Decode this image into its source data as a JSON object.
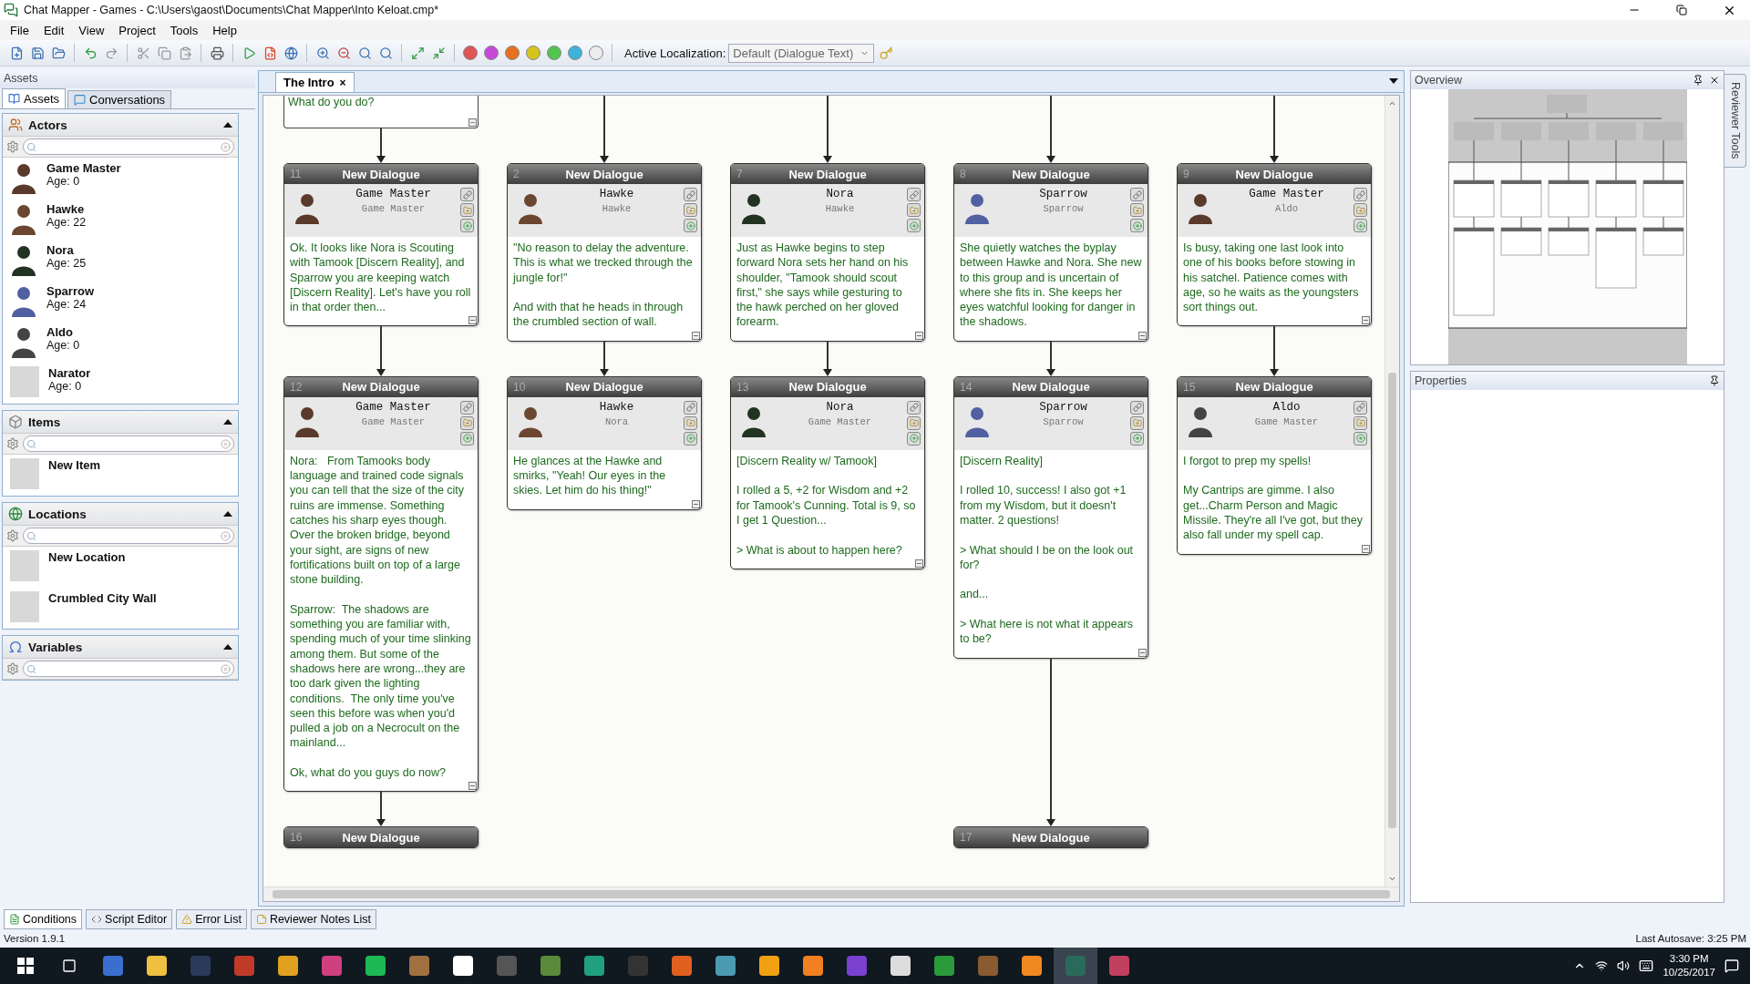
{
  "window": {
    "title": "Chat Mapper - Games - C:\\Users\\gaost\\Documents\\Chat Mapper\\Into Keloat.cmp*"
  },
  "menu": [
    "File",
    "Edit",
    "View",
    "Project",
    "Tools",
    "Help"
  ],
  "toolbar": {
    "color_buttons": [
      {
        "color": "#e05555"
      },
      {
        "color": "#c848d8"
      },
      {
        "color": "#e8701e"
      },
      {
        "color": "#d6c41c"
      },
      {
        "color": "#52c452"
      },
      {
        "color": "#3eb2d8"
      },
      {
        "color": "#ececec"
      }
    ],
    "localization_label": "Active Localization:",
    "localization_value": "Default (Dialogue Text)"
  },
  "assets_panel": {
    "title": "Assets",
    "tabs": [
      {
        "label": "Assets",
        "selected": true
      },
      {
        "label": "Conversations",
        "selected": false
      }
    ],
    "sections": [
      {
        "kind": "actors",
        "title": "Actors",
        "expanded": true,
        "items": [
          {
            "name": "Game Master",
            "detail": "Age: 0",
            "has_portrait": true
          },
          {
            "name": "Hawke",
            "detail": "Age: 22",
            "has_portrait": true
          },
          {
            "name": "Nora",
            "detail": "Age: 25",
            "has_portrait": true
          },
          {
            "name": "Sparrow",
            "detail": "Age: 24",
            "has_portrait": true
          },
          {
            "name": "Aldo",
            "detail": "Age: 0",
            "has_portrait": true
          },
          {
            "name": "Narator",
            "detail": "Age: 0",
            "has_portrait": false
          }
        ]
      },
      {
        "kind": "items",
        "title": "Items",
        "expanded": true,
        "items": [
          {
            "name": "New Item",
            "has_portrait": false
          }
        ]
      },
      {
        "kind": "locations",
        "title": "Locations",
        "expanded": true,
        "items": [
          {
            "name": "New Location",
            "has_portrait": false
          },
          {
            "name": "Crumbled City Wall",
            "has_portrait": false
          }
        ]
      },
      {
        "kind": "variables",
        "title": "Variables",
        "expanded": true
      }
    ]
  },
  "conversation": {
    "tab": {
      "label": "The Intro",
      "close": "×",
      "selected": true
    },
    "columns": [
      {
        "parent_text": "What do you do?",
        "nodes": [
          {
            "id": "11",
            "title": "New Dialogue",
            "actor": "Game Master",
            "conversant": "Game Master",
            "text": "Ok. It looks like Nora is Scouting with Tamook [Discern Reality], and Sparrow you are keeping watch [Discern Reality]. Let's have you roll in that order then..."
          },
          {
            "id": "12",
            "title": "New Dialogue",
            "actor": "Game Master",
            "conversant": "Game Master",
            "text": "Nora:   From Tamooks body language and trained code signals you can tell that the size of the city ruins are immense. Something catches his sharp eyes though. Over the broken bridge, beyond your sight, are signs of new fortifications built on top of a large stone building.\n\nSparrow:  The shadows are something you are familiar with, spending much of your time slinking among them. But some of the shadows here are wrong...they are too dark given the lighting conditions.  The only time you've seen this before was when you'd pulled a job on a Necrocult on the mainland...\n\nOk, what do you guys do now?"
          },
          {
            "id": "16",
            "title": "New Dialogue"
          }
        ]
      },
      {
        "nodes": [
          {
            "id": "2",
            "title": "New Dialogue",
            "actor": "Hawke",
            "conversant": "Hawke",
            "text": "\"No reason to delay the adventure. This is what we trecked through the jungle for!\"\n\nAnd with that he heads in through the crumbled section of wall."
          },
          {
            "id": "10",
            "title": "New Dialogue",
            "actor": "Hawke",
            "conversant": "Nora",
            "text": "He glances at the Hawke and smirks, \"Yeah! Our eyes in the skies. Let him do his thing!\""
          }
        ]
      },
      {
        "nodes": [
          {
            "id": "7",
            "title": "New Dialogue",
            "actor": "Nora",
            "conversant": "Hawke",
            "text": "Just as Hawke begins to step forward Nora sets her hand on his shoulder, \"Tamook should scout first,\" she says while gesturing to the hawk perched on her gloved forearm."
          },
          {
            "id": "13",
            "title": "New Dialogue",
            "actor": "Nora",
            "conversant": "Game Master",
            "text": "[Discern Reality w/ Tamook]\n\nI rolled a 5, +2 for Wisdom and +2 for Tamook's Cunning. Total is 9, so I get 1 Question...\n\n> What is about to happen here?"
          }
        ]
      },
      {
        "nodes": [
          {
            "id": "8",
            "title": "New Dialogue",
            "actor": "Sparrow",
            "conversant": "Sparrow",
            "text": "She quietly watches the byplay between Hawke and Nora. She new to this group and is uncertain of where she fits in. She keeps her eyes watchful looking for danger in the shadows."
          },
          {
            "id": "14",
            "title": "New Dialogue",
            "actor": "Sparrow",
            "conversant": "Sparrow",
            "text": "[Discern Reality]\n\nI rolled 10, success! I also got +1 from my Wisdom, but it doesn't matter. 2 questions!\n\n> What should I be on the look out for?\n\nand...\n\n> What here is not what it appears to be?"
          },
          {
            "id": "17",
            "title": "New Dialogue"
          }
        ]
      },
      {
        "nodes": [
          {
            "id": "9",
            "title": "New Dialogue",
            "actor": "Game Master",
            "conversant": "Aldo",
            "text": "Is busy, taking one last look into one of his books before stowing in his satchel. Patience comes with age, so he waits as the youngsters sort things out."
          },
          {
            "id": "15",
            "title": "New Dialogue",
            "actor": "Aldo",
            "conversant": "Game Master",
            "text": "I forgot to prep my spells!\n\nMy Cantrips are gimme. I also get...Charm Person and Magic Missile. They're all I've got, but they also fall under my spell cap."
          }
        ]
      }
    ]
  },
  "overview": {
    "title": "Overview"
  },
  "properties": {
    "title": "Properties"
  },
  "side_tab": {
    "label": "Reviewer Tools"
  },
  "bottom_tabs": [
    {
      "label": "Conditions",
      "selected": true
    },
    {
      "label": "Script Editor",
      "selected": false
    },
    {
      "label": "Error List",
      "selected": false
    },
    {
      "label": "Reviewer Notes List",
      "selected": false
    }
  ],
  "status_bar": {
    "version": "Version 1.9.1",
    "autosave": "Last Autosave: 3:25 PM"
  },
  "taskbar": {
    "time": "3:30 PM",
    "date": "10/25/2017"
  }
}
